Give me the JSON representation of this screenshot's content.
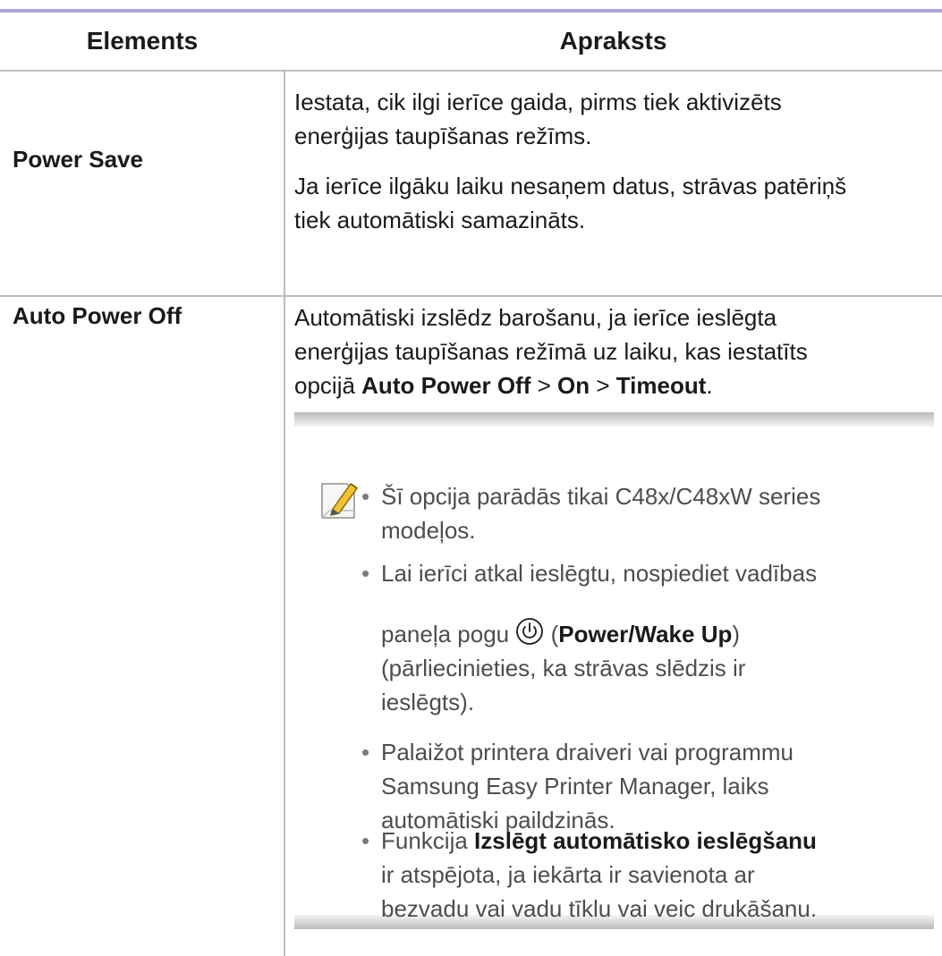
{
  "table": {
    "header": {
      "col1": "Elements",
      "col2": "Apraksts"
    },
    "rows": [
      {
        "element": "Power Save",
        "desc": [
          "Iestata, cik ilgi ierīce gaida, pirms tiek aktivizēts",
          "enerģijas taupīšanas režīms.",
          "Ja ierīce ilgāku laiku nesaņem datus, strāvas patēriņš",
          "tiek automātiski samazināts."
        ]
      },
      {
        "element": "Auto Power Off",
        "desc": {
          "line1": "Automātiski izslēdz barošanu, ja ierīce ieslēgta",
          "line2": "enerģijas taupīšanas režīmā uz laiku, kas iestatīts",
          "line3_prefix": "opcijā ",
          "line3_b1": "Auto Power Off",
          "line3_sep1": " > ",
          "line3_b2": "On",
          "line3_sep2": " > ",
          "line3_b3": "Timeout",
          "line3_suffix": "."
        },
        "note": {
          "icon": "note-pencil-icon",
          "bullets": {
            "b1": {
              "l1": "Šī opcija parādās tikai C48x/C48xW series",
              "l2": "modeļos."
            },
            "b2": {
              "l1": "Lai ierīci atkal ieslēgtu, nospiediet vadības",
              "l2_prefix": "paneļa pogu ",
              "l2_icon": "power-icon",
              "l2_open": " (",
              "l2_b": "Power/Wake Up",
              "l2_close": ")",
              "l3": "(pārliecinieties, ka strāvas slēdzis ir",
              "l4": "ieslēgts)."
            },
            "b3": {
              "l1": "Palaižot printera draiveri vai programmu",
              "l2": "Samsung Easy Printer Manager, laiks",
              "l3": "automātiski paildzinās."
            },
            "b4": {
              "l1_prefix": "Funkcija ",
              "l1_b": "Izslēgt automātisko ieslēgšanu",
              "l2": "ir atspējota, ja iekārta ir savienota ar",
              "l3": "bezvadu vai vadu tīklu vai veic drukāšanu."
            }
          }
        }
      }
    ]
  }
}
